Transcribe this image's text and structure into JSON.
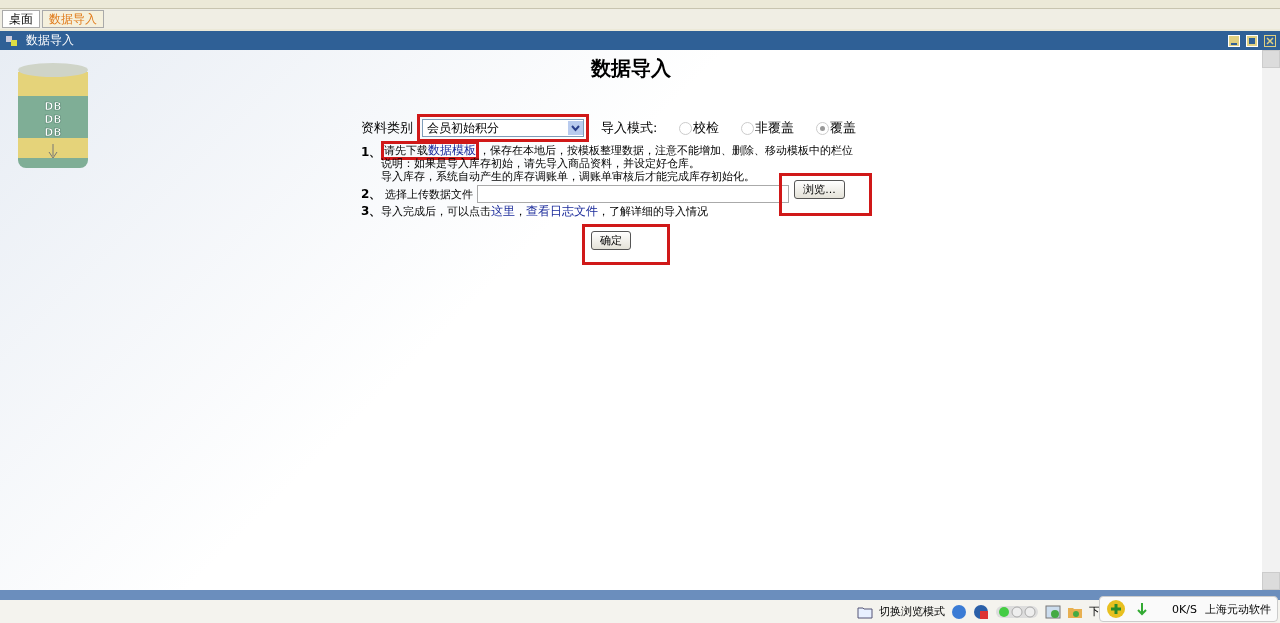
{
  "tabs": [
    {
      "label": "桌面",
      "selected": false
    },
    {
      "label": "数据导入",
      "selected": true
    }
  ],
  "window": {
    "title": "数据导入"
  },
  "decoration": {
    "labels": [
      "DB",
      "DB",
      "DB"
    ]
  },
  "page": {
    "heading": "数据导入",
    "category": {
      "label": "资料类别",
      "value": "会员初始积分",
      "highlighted": true
    },
    "mode": {
      "label": "导入模式:",
      "options": [
        {
          "label": "校检",
          "selected": false
        },
        {
          "label": "非覆盖",
          "selected": false
        },
        {
          "label": "覆盖",
          "selected": true
        }
      ]
    },
    "step1": {
      "number": "1、",
      "before": "请先下载",
      "link": "数据模板",
      "link_highlighted": true,
      "after": "，保存在本地后，按模板整理数据，注意不能增加、删除、移动模板中的栏位",
      "notes": [
        "说明：如果是导入库存初始，请先导入商品资料，并设定好仓库。",
        "导入库存，系统自动产生的库存调账单，调账单审核后才能完成库存初始化。"
      ]
    },
    "step2": {
      "number": "2、",
      "label": "选择上传数据文件",
      "button": "浏览...",
      "highlighted": true
    },
    "step3": {
      "number": "3、",
      "before": "导入完成后，可以点击",
      "link1": "这里",
      "sep": "，",
      "link2": "查看日志文件",
      "after": "，了解详细的导入情况"
    },
    "confirm": {
      "label": "确定",
      "highlighted": true
    }
  },
  "status_bar": {
    "mode": "切换浏览模式",
    "cut": "下",
    "popup": {
      "speed": "0K/S",
      "company": "上海元动软件"
    }
  }
}
